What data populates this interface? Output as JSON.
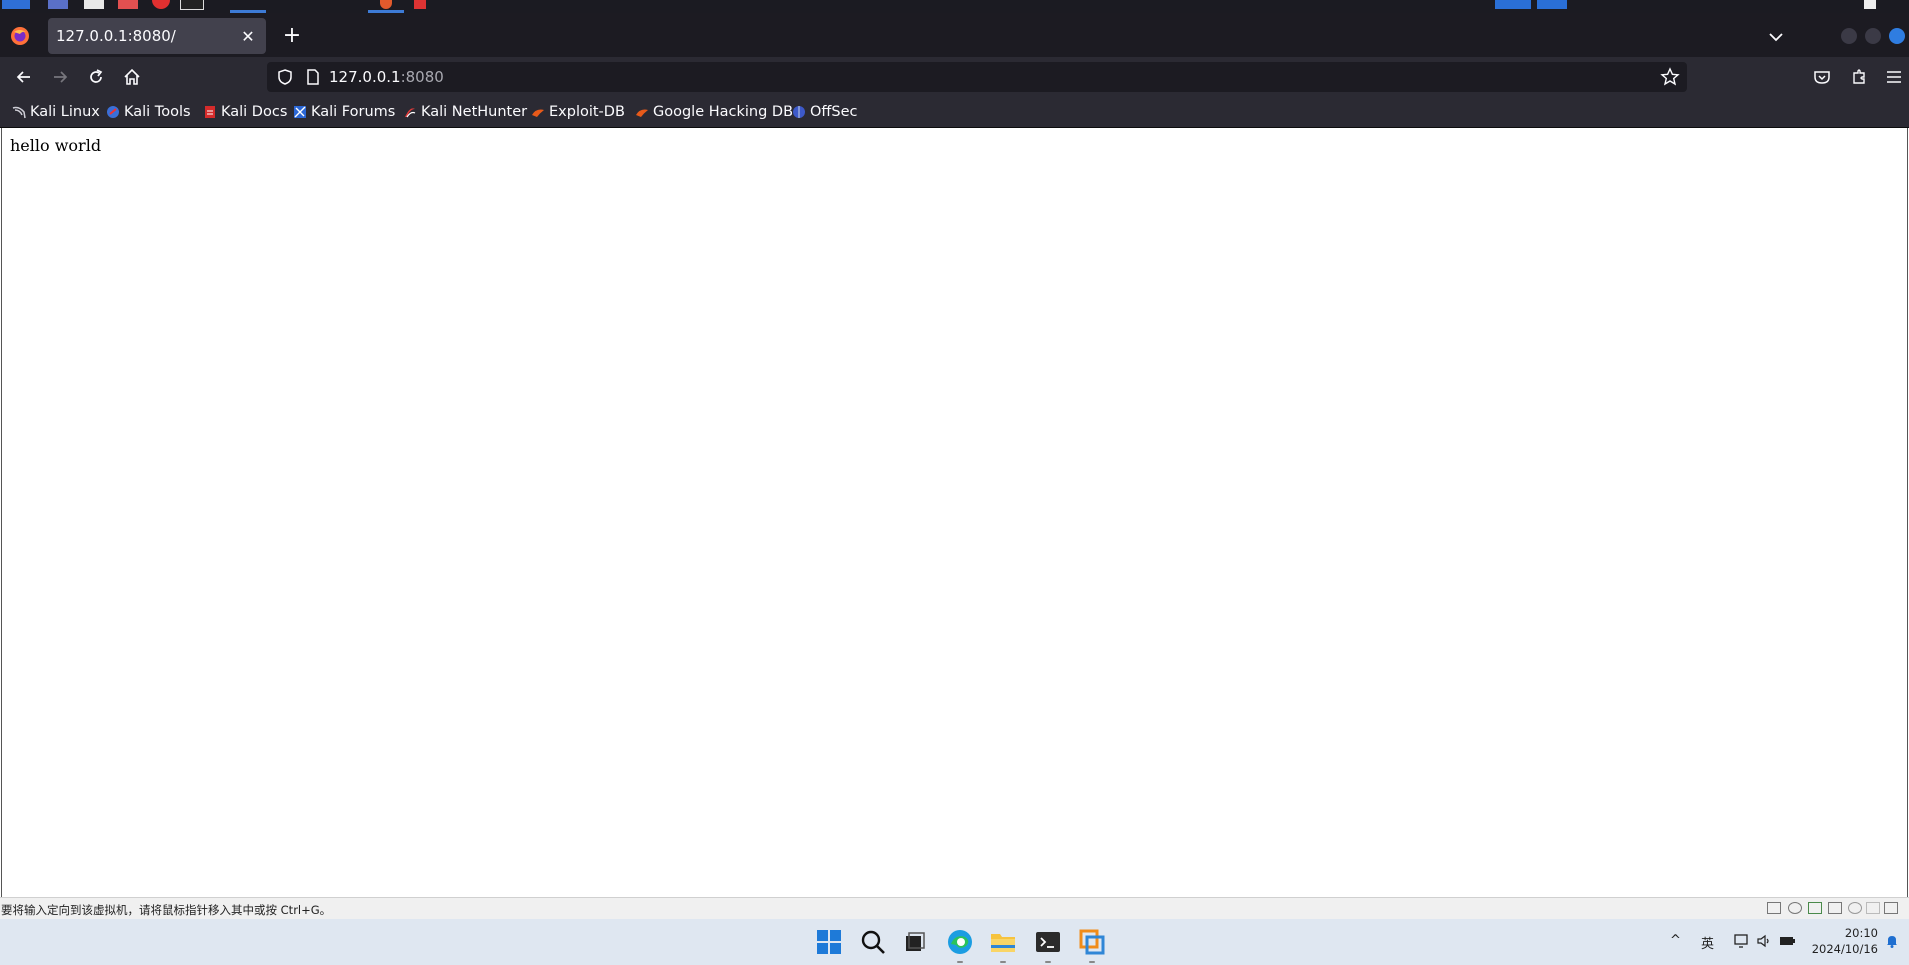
{
  "browser": {
    "tab_title": "127.0.0.1:8080/",
    "url_host": "127.0.0.1",
    "url_port": ":8080"
  },
  "bookmarks": [
    {
      "label": "Kali Linux",
      "icon": "kali-dragon-icon"
    },
    {
      "label": "Kali Tools",
      "icon": "kali-tools-icon"
    },
    {
      "label": "Kali Docs",
      "icon": "kali-docs-icon"
    },
    {
      "label": "Kali Forums",
      "icon": "kali-forums-icon"
    },
    {
      "label": "Kali NetHunter",
      "icon": "nethunter-icon"
    },
    {
      "label": "Exploit-DB",
      "icon": "exploit-db-icon"
    },
    {
      "label": "Google Hacking DB",
      "icon": "ghdb-icon"
    },
    {
      "label": "OffSec",
      "icon": "offsec-icon"
    }
  ],
  "page": {
    "body_text": "hello world"
  },
  "vm_status": {
    "hint": "要将输入定向到该虚拟机，请将鼠标指针移入其中或按 Ctrl+G。"
  },
  "taskbar": {
    "ime": "英",
    "time": "20:10",
    "date": "2024/10/16"
  },
  "colors": {
    "accent": "#3d7bd6",
    "tab_bg": "#42414d",
    "toolbar_bg": "#2b2a33",
    "titlebar_bg": "#1c1b22",
    "taskbar_bg": "#dfe7f1"
  }
}
